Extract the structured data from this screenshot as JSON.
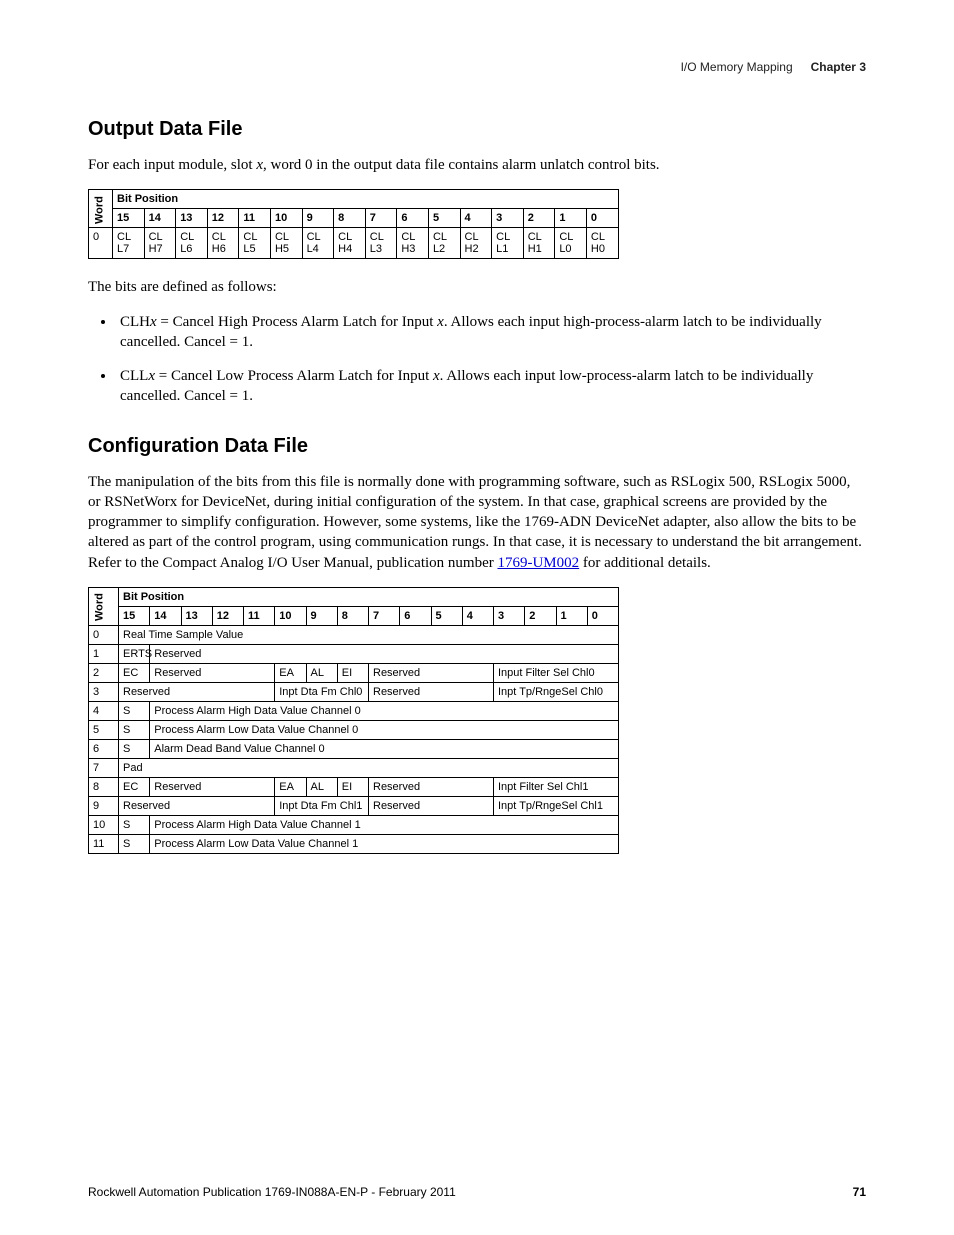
{
  "header": {
    "section": "I/O Memory Mapping",
    "chapter": "Chapter 3"
  },
  "output_section": {
    "title": "Output Data File",
    "intro_a": "For each input module, slot ",
    "intro_x": "x",
    "intro_b": ", word 0 in the output data file contains alarm unlatch control bits.",
    "word_label": "Word",
    "bp_label": "Bit Position",
    "bits": [
      "15",
      "14",
      "13",
      "12",
      "11",
      "10",
      "9",
      "8",
      "7",
      "6",
      "5",
      "4",
      "3",
      "2",
      "1",
      "0"
    ],
    "word0": "0",
    "cells": [
      "CL L7",
      "CL H7",
      "CL L6",
      "CL H6",
      "CL L5",
      "CL H5",
      "CL L4",
      "CL H4",
      "CL L3",
      "CL H3",
      "CL L2",
      "CL H2",
      "CL L1",
      "CL H1",
      "CL L0",
      "CL H0"
    ],
    "defined": "The bits are defined as follows:",
    "li1_a": "CLH",
    "li1_x": "x",
    "li1_b": " = Cancel High Process Alarm Latch for Input ",
    "li1_x2": "x",
    "li1_c": ". Allows each input high-process-alarm latch to be individually cancelled. Cancel = 1.",
    "li2_a": "CLL",
    "li2_x": "x",
    "li2_b": " = Cancel Low Process Alarm Latch for Input ",
    "li2_x2": "x",
    "li2_c": ". Allows each input low-process-alarm latch to be individually cancelled. Cancel = 1."
  },
  "config_section": {
    "title": "Configuration Data File",
    "para_a": "The manipulation of the bits from this file is normally done with programming software, such as RSLogix 500, RSLogix 5000, or RSNetWorx for DeviceNet, during initial configuration of the system. In that case, graphical screens are provided by the programmer to simplify configuration. However, some systems, like the 1769-ADN DeviceNet adapter, also allow the bits to be altered as part of the control program, using communication rungs. In that case, it is necessary to understand the bit arrangement. Refer to the Compact Analog I/O User Manual, publication number ",
    "link": "1769-UM002",
    "para_b": " for additional details.",
    "word_label": "Word",
    "bp_label": "Bit Position",
    "bits": [
      "15",
      "14",
      "13",
      "12",
      "11",
      "10",
      "9",
      "8",
      "7",
      "6",
      "5",
      "4",
      "3",
      "2",
      "1",
      "0"
    ],
    "rows": {
      "w0": "0",
      "r0": "Real Time Sample Value",
      "w1": "1",
      "r1a": "ERTS",
      "r1b": "Reserved",
      "w2": "2",
      "r2a": "EC",
      "r2b": "Reserved",
      "r2c": "EA",
      "r2d": "AL",
      "r2e": "EI",
      "r2f": "Reserved",
      "r2g": "Input Filter Sel Chl0",
      "w3": "3",
      "r3a": "Reserved",
      "r3b": "Inpt Dta Fm Chl0",
      "r3c": "Reserved",
      "r3d": "Inpt Tp/RngeSel Chl0",
      "w4": "4",
      "r4a": "S",
      "r4b": "Process Alarm High Data Value Channel 0",
      "w5": "5",
      "r5a": "S",
      "r5b": "Process Alarm Low Data Value Channel 0",
      "w6": "6",
      "r6a": "S",
      "r6b": "Alarm Dead Band Value Channel 0",
      "w7": "7",
      "r7a": "Pad",
      "w8": "8",
      "r8a": "EC",
      "r8b": "Reserved",
      "r8c": "EA",
      "r8d": "AL",
      "r8e": "EI",
      "r8f": "Reserved",
      "r8g": "Inpt Filter Sel Chl1",
      "w9": "9",
      "r9a": "Reserved",
      "r9b": "Inpt Dta Fm Chl1",
      "r9c": "Reserved",
      "r9d": "Inpt Tp/RngeSel Chl1",
      "w10": "10",
      "r10a": "S",
      "r10b": "Process Alarm High Data Value Channel 1",
      "w11": "11",
      "r11a": "S",
      "r11b": "Process Alarm Low Data Value Channel 1"
    }
  },
  "footer": {
    "pub": "Rockwell Automation Publication 1769-IN088A-EN-P - February 2011",
    "page": "71"
  }
}
